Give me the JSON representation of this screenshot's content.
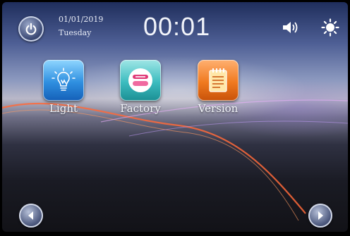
{
  "status_bar": {
    "date": "01/01/2019",
    "weekday": "Tuesday",
    "time": "00:01"
  },
  "apps": [
    {
      "label": "Light",
      "icon": "light-bulb-icon"
    },
    {
      "label": "Factory",
      "icon": "factory-icon"
    },
    {
      "label": "Version",
      "icon": "notepad-icon"
    }
  ],
  "icons": {
    "power": "power-icon",
    "volume": "speaker-icon",
    "brightness": "sun-icon",
    "prev": "arrow-left-icon",
    "next": "arrow-right-icon"
  },
  "colors": {
    "light_tile": "#2f8fe0",
    "factory_tile": "#3cbcbf",
    "version_tile": "#f07a20"
  }
}
